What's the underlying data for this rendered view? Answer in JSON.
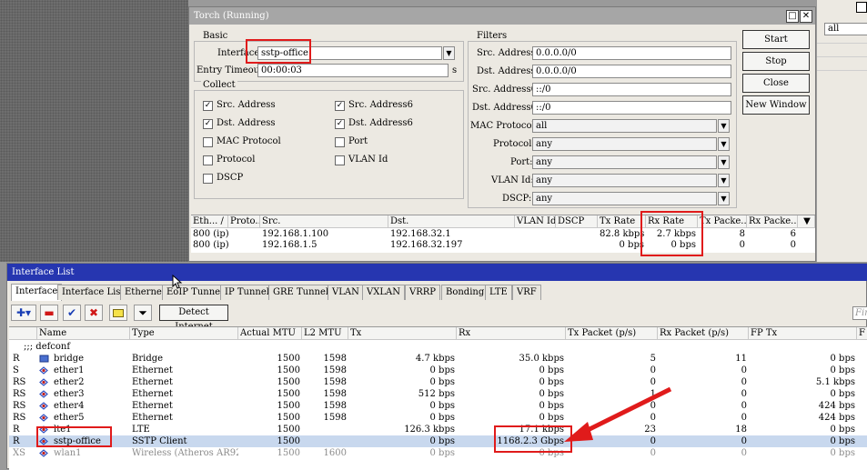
{
  "torch": {
    "title": "Torch (Running)",
    "basic": {
      "title": "Basic",
      "interface_label": "Interface:",
      "interface_value": "sstp-office",
      "entry_timeout_label": "Entry Timeout:",
      "entry_timeout_value": "00:00:03",
      "entry_timeout_unit": "s"
    },
    "collect": {
      "title": "Collect",
      "items": [
        {
          "label": "Src. Address",
          "checked": true
        },
        {
          "label": "Src. Address6",
          "checked": true
        },
        {
          "label": "Dst. Address",
          "checked": true
        },
        {
          "label": "Dst. Address6",
          "checked": true
        },
        {
          "label": "MAC Protocol",
          "checked": false
        },
        {
          "label": "Port",
          "checked": false
        },
        {
          "label": "Protocol",
          "checked": false
        },
        {
          "label": "VLAN Id",
          "checked": false
        },
        {
          "label": "DSCP",
          "checked": false
        }
      ]
    },
    "filters": {
      "title": "Filters",
      "src_address_label": "Src. Address:",
      "src_address_value": "0.0.0.0/0",
      "dst_address_label": "Dst. Address:",
      "dst_address_value": "0.0.0.0/0",
      "src_address6_label": "Src. Address6:",
      "src_address6_value": "::/0",
      "dst_address6_label": "Dst. Address6:",
      "dst_address6_value": "::/0",
      "mac_protocol_label": "MAC Protocol:",
      "mac_protocol_value": "all",
      "protocol_label": "Protocol:",
      "protocol_value": "any",
      "port_label": "Port:",
      "port_value": "any",
      "vlan_id_label": "VLAN Id:",
      "vlan_id_value": "any",
      "dscp_label": "DSCP:",
      "dscp_value": "any"
    },
    "buttons": {
      "start": "Start",
      "stop": "Stop",
      "close": "Close",
      "new_window": "New Window"
    },
    "table": {
      "headers": [
        "Eth... /",
        "Proto...",
        "Src.",
        "Dst.",
        "VLAN Id",
        "DSCP",
        "Tx Rate",
        "Rx Rate",
        "Tx Packe...",
        "Rx Packe..."
      ],
      "rows": [
        [
          "800 (ip)",
          "",
          "192.168.1.100",
          "192.168.32.1",
          "",
          "",
          "82.8 kbps",
          "2.7 kbps",
          "8",
          "6"
        ],
        [
          "800 (ip)",
          "",
          "192.168.1.5",
          "192.168.32.197",
          "",
          "",
          "0 bps",
          "0 bps",
          "0",
          "0"
        ]
      ]
    }
  },
  "right_window": {
    "filter_value": "all"
  },
  "interface_list": {
    "title": "Interface List",
    "tabs": [
      "Interface",
      "Interface List",
      "Ethernet",
      "EoIP Tunnel",
      "IP Tunnel",
      "GRE Tunnel",
      "VLAN",
      "VXLAN",
      "VRRP",
      "Bonding",
      "LTE",
      "VRF"
    ],
    "toolbar": {
      "detect_internet": "Detect Internet",
      "find_placeholder": "Fin"
    },
    "headers": [
      "Name",
      "Type",
      "Actual MTU",
      "L2 MTU",
      "Tx",
      "Rx",
      "Tx Packet (p/s)",
      "Rx Packet (p/s)",
      "FP Tx",
      "F"
    ],
    "section": ";;; defconf",
    "rows": [
      {
        "flag": "R",
        "name": "bridge",
        "type": "Bridge",
        "mtu": "1500",
        "l2mtu": "1598",
        "tx": "4.7 kbps",
        "rx": "35.0 kbps",
        "txp": "5",
        "rxp": "11",
        "fptx": "0 bps"
      },
      {
        "flag": "S",
        "name": "ether1",
        "type": "Ethernet",
        "mtu": "1500",
        "l2mtu": "1598",
        "tx": "0 bps",
        "rx": "0 bps",
        "txp": "0",
        "rxp": "0",
        "fptx": "0 bps"
      },
      {
        "flag": "RS",
        "name": "ether2",
        "type": "Ethernet",
        "mtu": "1500",
        "l2mtu": "1598",
        "tx": "0 bps",
        "rx": "0 bps",
        "txp": "0",
        "rxp": "0",
        "fptx": "5.1 kbps"
      },
      {
        "flag": "RS",
        "name": "ether3",
        "type": "Ethernet",
        "mtu": "1500",
        "l2mtu": "1598",
        "tx": "512 bps",
        "rx": "0 bps",
        "txp": "1",
        "rxp": "0",
        "fptx": "0 bps"
      },
      {
        "flag": "RS",
        "name": "ether4",
        "type": "Ethernet",
        "mtu": "1500",
        "l2mtu": "1598",
        "tx": "0 bps",
        "rx": "0 bps",
        "txp": "0",
        "rxp": "0",
        "fptx": "424 bps"
      },
      {
        "flag": "RS",
        "name": "ether5",
        "type": "Ethernet",
        "mtu": "1500",
        "l2mtu": "1598",
        "tx": "0 bps",
        "rx": "0 bps",
        "txp": "0",
        "rxp": "0",
        "fptx": "424 bps"
      },
      {
        "flag": "R",
        "name": "lte1",
        "type": "LTE",
        "mtu": "1500",
        "l2mtu": "",
        "tx": "126.3 kbps",
        "rx": "17.1 kbps",
        "txp": "23",
        "rxp": "18",
        "fptx": "0 bps"
      },
      {
        "flag": "R",
        "name": "sstp-office",
        "type": "SSTP Client",
        "mtu": "1500",
        "l2mtu": "",
        "tx": "0 bps",
        "rx": "1168.2.3 Gbps",
        "txp": "0",
        "rxp": "0",
        "fptx": "0 bps"
      },
      {
        "flag": "XS",
        "name": "wlan1",
        "type": "Wireless (Atheros AR92xx)",
        "mtu": "1500",
        "l2mtu": "1600",
        "tx": "0 bps",
        "rx": "0 bps",
        "txp": "0",
        "rxp": "0",
        "fptx": "0 bps"
      }
    ]
  },
  "colors": {
    "highlight": "#e01b1b",
    "title_active": "#2636b0",
    "title_inactive": "#a6a6a6",
    "selected_row": "#c8d8ee"
  }
}
